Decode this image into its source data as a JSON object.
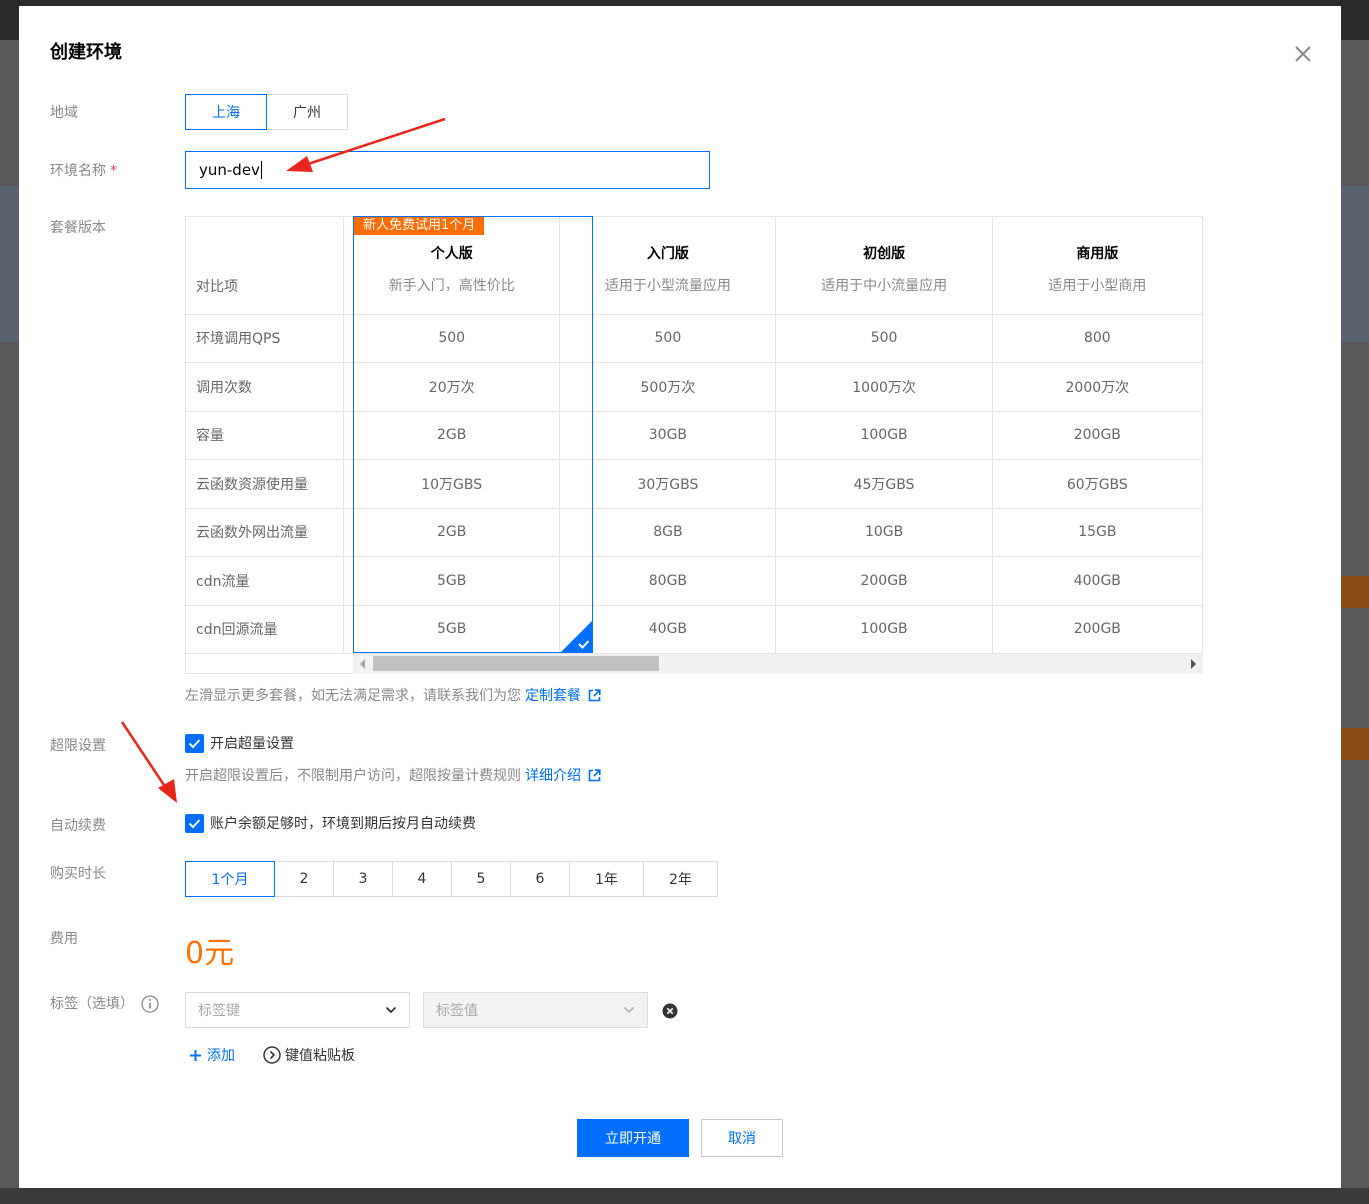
{
  "dialog": {
    "title": "创建环境"
  },
  "region": {
    "label": "地域",
    "options": [
      "上海",
      "广州"
    ],
    "selected": "上海"
  },
  "env_name": {
    "label": "环境名称",
    "required_mark": "*",
    "value": "yun-dev"
  },
  "plan": {
    "label": "套餐版本",
    "compare_header": "对比项",
    "promo_badge": "新人免费试用1个月",
    "plans": [
      {
        "name": "个人版",
        "desc": "新手入门，高性价比",
        "values": [
          "500",
          "20万次",
          "2GB",
          "10万GBS",
          "2GB",
          "5GB",
          "5GB"
        ]
      },
      {
        "name": "入门版",
        "desc": "适用于小型流量应用",
        "values": [
          "500",
          "500万次",
          "30GB",
          "30万GBS",
          "8GB",
          "80GB",
          "40GB"
        ]
      },
      {
        "name": "初创版",
        "desc": "适用于中小流量应用",
        "values": [
          "500",
          "1000万次",
          "100GB",
          "45万GBS",
          "10GB",
          "200GB",
          "100GB"
        ]
      },
      {
        "name": "商用版",
        "desc": "适用于小型商用",
        "values": [
          "800",
          "2000万次",
          "200GB",
          "60万GBS",
          "15GB",
          "400GB",
          "200GB"
        ]
      }
    ],
    "rows": [
      "环境调用QPS",
      "调用次数",
      "容量",
      "云函数资源使用量",
      "云函数外网出流量",
      "cdn流量",
      "cdn回源流量"
    ],
    "hint": "左滑显示更多套餐，如无法满足需求，请联系我们为您",
    "hint_link": "定制套餐"
  },
  "overlimit": {
    "label": "超限设置",
    "checkbox_label": "开启超量设置",
    "checked": true,
    "hint": "开启超限设置后，不限制用户访问，超限按量计费规则",
    "hint_link": "详细介绍"
  },
  "auto_renew": {
    "label": "自动续费",
    "checkbox_label": "账户余额足够时，环境到期后按月自动续费",
    "checked": true
  },
  "duration": {
    "label": "购买时长",
    "options": [
      "1个月",
      "2",
      "3",
      "4",
      "5",
      "6",
      "1年",
      "2年"
    ],
    "selected": "1个月"
  },
  "fee": {
    "label": "费用",
    "value": "0元"
  },
  "tags": {
    "label": "标签（选填）",
    "key_placeholder": "标签键",
    "value_placeholder": "标签值",
    "add_label": "添加",
    "paste_label": "键值粘贴板"
  },
  "actions": {
    "submit": "立即开通",
    "cancel": "取消"
  },
  "colors": {
    "primary": "#006eff",
    "promo": "#ff6c00",
    "fee": "#ff7200",
    "annotation_arrow": "#e8261c"
  }
}
